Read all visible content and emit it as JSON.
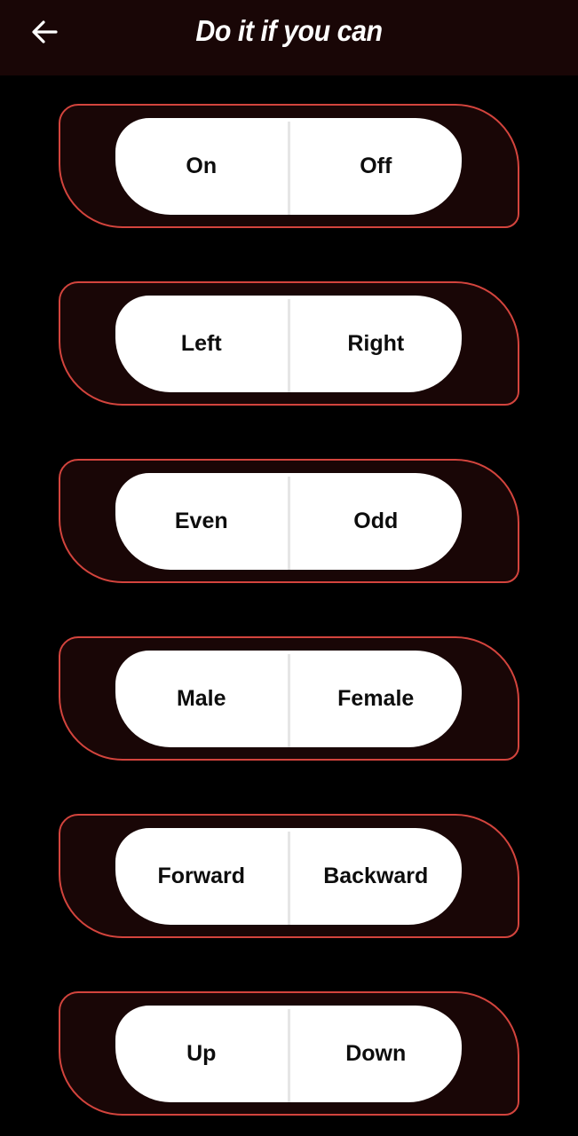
{
  "app_bar": {
    "back_icon": "arrow-left-icon",
    "title": "Do it if you can"
  },
  "colors": {
    "background": "#000000",
    "card_background": "#190606",
    "card_border": "#d3443d",
    "toggle_background": "#ffffff",
    "toggle_text": "#0d0d0d",
    "title_text": "#ffffff"
  },
  "toggles": [
    {
      "left": "On",
      "right": "Off"
    },
    {
      "left": "Left",
      "right": "Right"
    },
    {
      "left": "Even",
      "right": "Odd"
    },
    {
      "left": "Male",
      "right": "Female"
    },
    {
      "left": "Forward",
      "right": "Backward"
    },
    {
      "left": "Up",
      "right": "Down"
    }
  ]
}
